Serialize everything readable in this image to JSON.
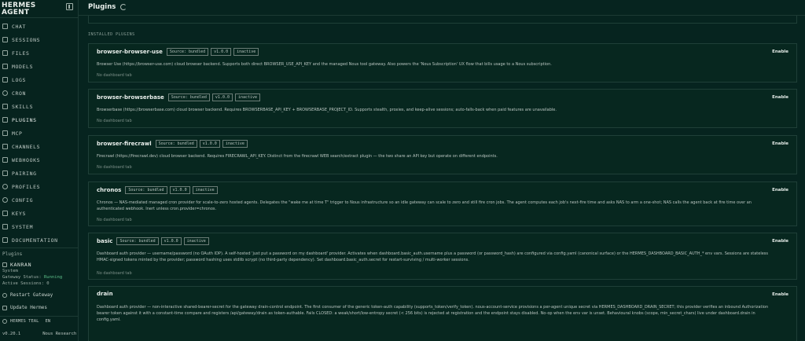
{
  "app": {
    "brand_line1": "HERMES",
    "brand_line2": "AGENT"
  },
  "sidebar": {
    "items": [
      {
        "label": "CHAT",
        "icon": "chat-icon"
      },
      {
        "label": "SESSIONS",
        "icon": "sessions-icon"
      },
      {
        "label": "FILES",
        "icon": "files-icon"
      },
      {
        "label": "MODELS",
        "icon": "models-icon"
      },
      {
        "label": "LOGS",
        "icon": "logs-icon"
      },
      {
        "label": "CRON",
        "icon": "cron-icon"
      },
      {
        "label": "SKILLS",
        "icon": "skills-icon"
      },
      {
        "label": "PLUGINS",
        "icon": "plugins-icon"
      },
      {
        "label": "MCP",
        "icon": "mcp-icon"
      },
      {
        "label": "CHANNELS",
        "icon": "channels-icon"
      },
      {
        "label": "WEBHOOKS",
        "icon": "webhooks-icon"
      },
      {
        "label": "PAIRING",
        "icon": "pairing-icon"
      },
      {
        "label": "PROFILES",
        "icon": "profiles-icon"
      },
      {
        "label": "CONFIG",
        "icon": "config-icon"
      },
      {
        "label": "KEYS",
        "icon": "keys-icon"
      },
      {
        "label": "SYSTEM",
        "icon": "system-icon"
      },
      {
        "label": "DOCUMENTATION",
        "icon": "documentation-icon"
      }
    ],
    "plugins_section": "Plugins",
    "plugin_item": "KANRAN",
    "system_label": "System",
    "gateway_status_label": "Gateway Status:",
    "gateway_status_value": "Running",
    "active_sessions": "Active Sessions: 0",
    "restart_gateway": "Restart Gateway",
    "update_hermes": "Update Hermes",
    "theme_label": "HERMES TEAL",
    "lang_label": "EN",
    "version": "v0.20.1",
    "vendor": "Nous Research"
  },
  "main": {
    "title": "Plugins",
    "section_label": "INSTALLED PLUGINS",
    "plugins": [
      {
        "name": "browser-browser-use",
        "source": "Source: bundled",
        "version": "v1.0.0",
        "status": "inactive",
        "enable": "Enable",
        "description": "Browser Use (https://browser-use.com) cloud browser backend. Supports both direct BROWSER_USE_API_KEY and the managed Nous tool gateway. Also powers the 'Nous Subscription' UX flow that bills usage to a Nous subscription.",
        "tab": "No dashboard tab"
      },
      {
        "name": "browser-browserbase",
        "source": "Source: bundled",
        "version": "v1.0.0",
        "status": "inactive",
        "enable": "Enable",
        "description": "Browserbase (https://browserbase.com) cloud browser backend. Requires BROWSERBASE_API_KEY + BROWSERBASE_PROJECT_ID. Supports stealth, proxies, and keep-alive sessions; auto-falls-back when paid features are unavailable.",
        "tab": "No dashboard tab"
      },
      {
        "name": "browser-firecrawl",
        "source": "Source: bundled",
        "version": "v1.0.0",
        "status": "inactive",
        "enable": "Enable",
        "description": "Firecrawl (https://firecrawl.dev) cloud browser backend. Requires FIRECRAWL_API_KEY. Distinct from the firecrawl WEB search/extract plugin — the two share an API key but operate on different endpoints.",
        "tab": "No dashboard tab"
      },
      {
        "name": "chronos",
        "source": "Source: bundled",
        "version": "v1.0.0",
        "status": "inactive",
        "enable": "Enable",
        "description": "Chronos — NAS-mediated managed cron provider for scale-to-zero hosted agents. Delegates the \"wake me at time T\" trigger to Nous infrastructure so an idle gateway can scale to zero and still fire cron jobs. The agent computes each job's next-fire time and asks NAS to arm a one-shot; NAS calls the agent back at fire time over an authenticated webhook. Inert unless cron.provider=chronos.",
        "tab": "No dashboard tab"
      },
      {
        "name": "basic",
        "source": "Source: bundled",
        "version": "v1.0.0",
        "status": "inactive",
        "enable": "Enable",
        "description": "Dashboard auth provider — username/password (no OAuth IDP). A self-hosted 'just put a password on my dashboard' provider. Activates when dashboard.basic_auth.username plus a password (or password_hash) are configured via config.yaml (canonical surface) or the HERMES_DASHBOARD_BASIC_AUTH_* env vars. Sessions are stateless HMAC-signed tokens minted by the provider; password hashing uses stdlib scrypt (no third-party dependency). Set dashboard.basic_auth.secret for restart-surviving / multi-worker sessions.",
        "tab": "No dashboard tab"
      },
      {
        "name": "drain",
        "source": "",
        "version": "",
        "status": "",
        "enable": "Enable",
        "description": "Dashboard auth provider — non-interactive shared-bearer-secret for the gateway drain-control endpoint. The first consumer of the generic token-auth capability (supports_token/verify_token). nous-account-service provisions a per-agent unique secret via HERMES_DASHBOARD_DRAIN_SECRET; this provider verifies an inbound Authorization bearer token against it with a constant-time compare and registers /api/gateway/drain as token-authable. Fails CLOSED: a weak/short/low-entropy secret (< 256 bits) is rejected at registration and the endpoint stays disabled. No-op when the env var is unset. Behavioural knobs (scope, min_secret_chars) live under dashboard.drain in config.yaml.",
        "tab": ""
      }
    ]
  }
}
